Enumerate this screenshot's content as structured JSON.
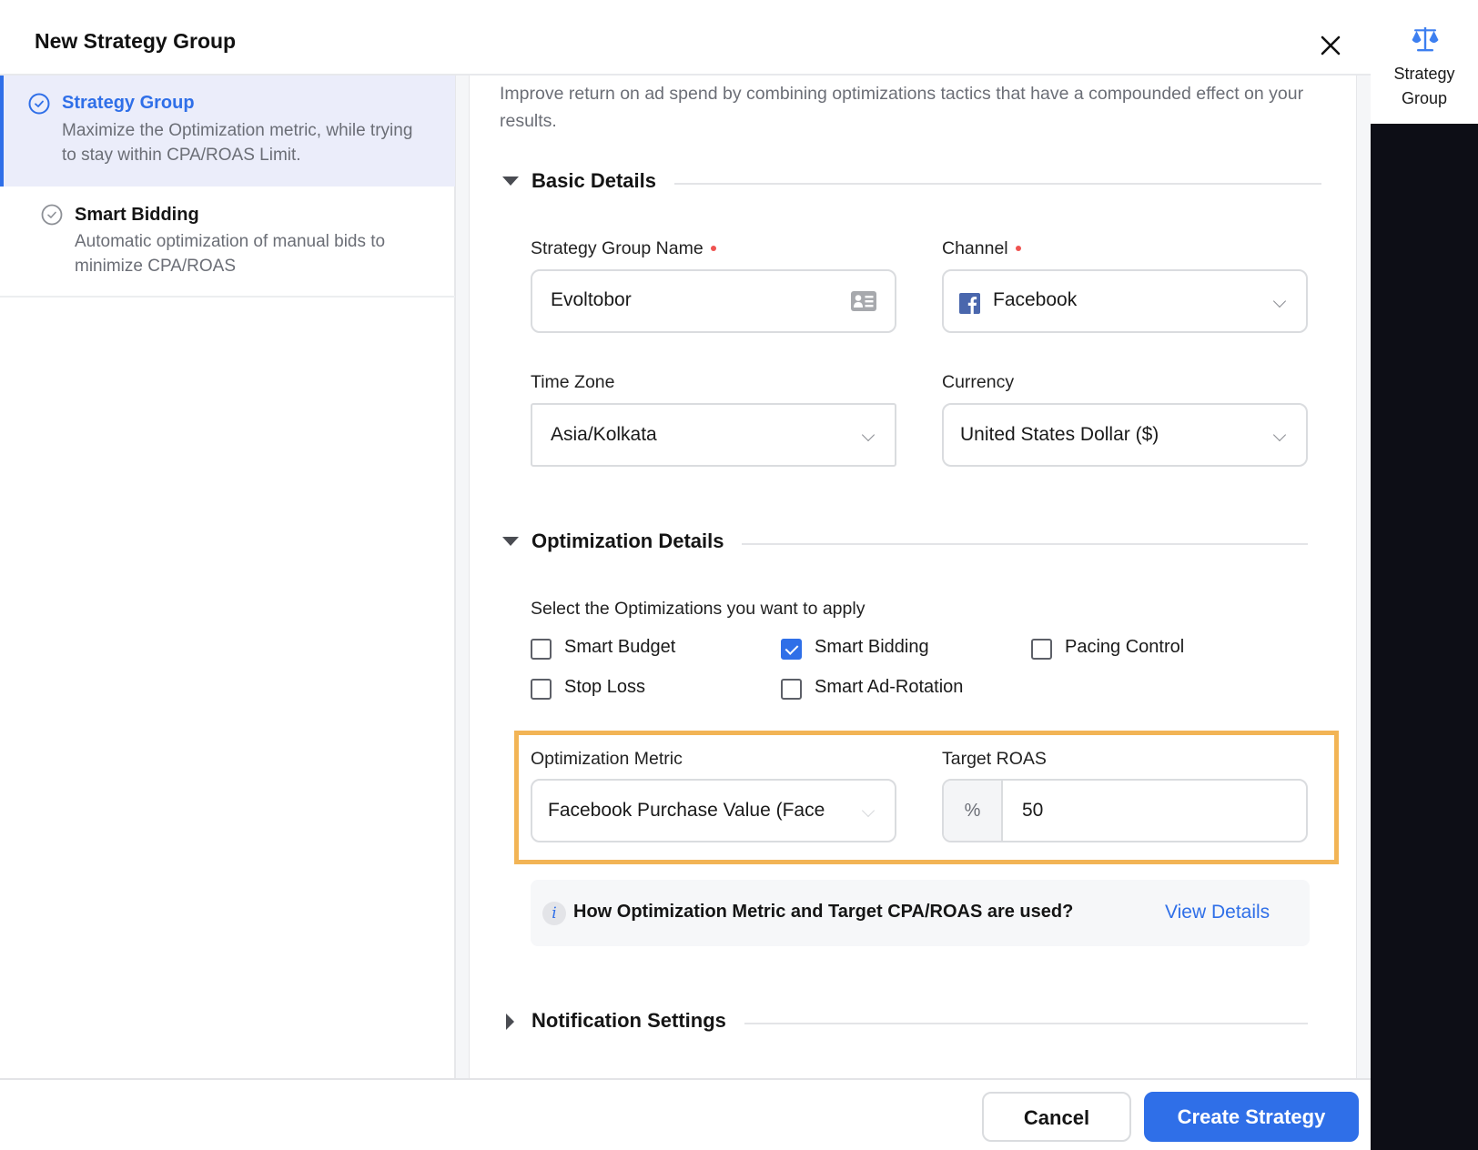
{
  "modal": {
    "title": "New Strategy Group",
    "close_icon": "close-icon"
  },
  "nav": {
    "items": [
      {
        "title": "Strategy Group",
        "description": "Maximize the Optimization metric, while trying to stay within CPA/ROAS Limit.",
        "icon": "check-circle-icon",
        "active": true
      },
      {
        "title": "Smart Bidding",
        "description": "Automatic optimization of manual bids to minimize CPA/ROAS",
        "icon": "check-circle-icon",
        "active": false
      }
    ]
  },
  "content": {
    "intro": "Improve return on ad spend by combining optimizations tactics that have a compounded effect on your results.",
    "basic_details": {
      "heading": "Basic Details",
      "strategy_group_name": {
        "label": "Strategy Group Name",
        "required": true,
        "value": "Evoltobor",
        "icon": "contact-card-icon"
      },
      "channel": {
        "label": "Channel",
        "required": true,
        "value": "Facebook",
        "icon": "facebook-icon"
      },
      "time_zone": {
        "label": "Time Zone",
        "value": "Asia/Kolkata"
      },
      "currency": {
        "label": "Currency",
        "value": "United States Dollar ($)"
      }
    },
    "optimization_details": {
      "heading": "Optimization Details",
      "prompt": "Select the Optimizations you want to apply",
      "options": [
        {
          "label": "Smart Budget",
          "checked": false
        },
        {
          "label": "Smart Bidding",
          "checked": true
        },
        {
          "label": "Pacing Control",
          "checked": false
        },
        {
          "label": "Stop Loss",
          "checked": false
        },
        {
          "label": "Smart Ad-Rotation",
          "checked": false
        }
      ],
      "optimization_metric": {
        "label": "Optimization Metric",
        "value": "Facebook Purchase Value (Face"
      },
      "target_roas": {
        "label": "Target ROAS",
        "prefix": "%",
        "value": "50"
      },
      "info": {
        "icon_glyph": "i",
        "text": "How Optimization Metric and Target CPA/ROAS are used?",
        "link": "View Details"
      }
    },
    "notification_settings": {
      "heading": "Notification Settings"
    }
  },
  "footer": {
    "cancel_label": "Cancel",
    "create_label": "Create Strategy"
  },
  "rail": {
    "tab_label": "Strategy Group",
    "icon": "scale-icon"
  },
  "colors": {
    "accent": "#2f6fe8",
    "highlight": "#f2b455",
    "required": "#ef5350",
    "facebook": "#4a67ad"
  }
}
